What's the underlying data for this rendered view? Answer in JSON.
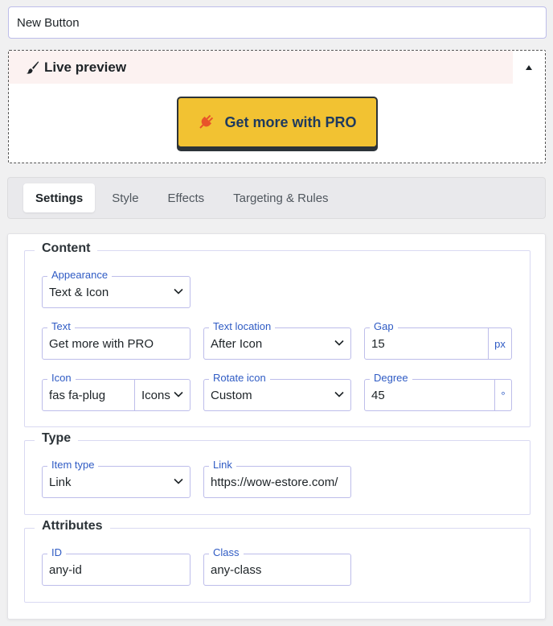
{
  "title_input": {
    "value": "New Button"
  },
  "preview": {
    "title": "Live preview",
    "brush_icon": "paintbrush-icon",
    "toggle_icon": "caret-up-icon",
    "button": {
      "label": "Get more with PRO",
      "icon": "plug-icon",
      "bg_color": "#f2c232",
      "text_color": "#1e3a5f",
      "icon_color": "#e8542a"
    }
  },
  "tabs": [
    {
      "label": "Settings",
      "active": true
    },
    {
      "label": "Style",
      "active": false
    },
    {
      "label": "Effects",
      "active": false
    },
    {
      "label": "Targeting & Rules",
      "active": false
    }
  ],
  "content": {
    "legend": "Content",
    "appearance": {
      "label": "Appearance",
      "value": "Text & Icon"
    },
    "text": {
      "label": "Text",
      "value": "Get more with PRO"
    },
    "text_location": {
      "label": "Text location",
      "value": "After Icon"
    },
    "gap": {
      "label": "Gap",
      "value": "15",
      "unit": "px"
    },
    "icon": {
      "label": "Icon",
      "value": "fas fa-plug",
      "type": "Icons"
    },
    "rotate_icon": {
      "label": "Rotate icon",
      "value": "Custom"
    },
    "degree": {
      "label": "Degree",
      "value": "45",
      "unit": "°"
    }
  },
  "type": {
    "legend": "Type",
    "item_type": {
      "label": "Item type",
      "value": "Link"
    },
    "link": {
      "label": "Link",
      "value": "https://wow-estore.com/"
    }
  },
  "attributes": {
    "legend": "Attributes",
    "id": {
      "label": "ID",
      "value": "any-id"
    },
    "class": {
      "label": "Class",
      "value": "any-class"
    }
  },
  "colors": {
    "accent": "#2f5bc4",
    "border": "#bdbdea",
    "preview_header_bg": "#fcf2f1"
  }
}
